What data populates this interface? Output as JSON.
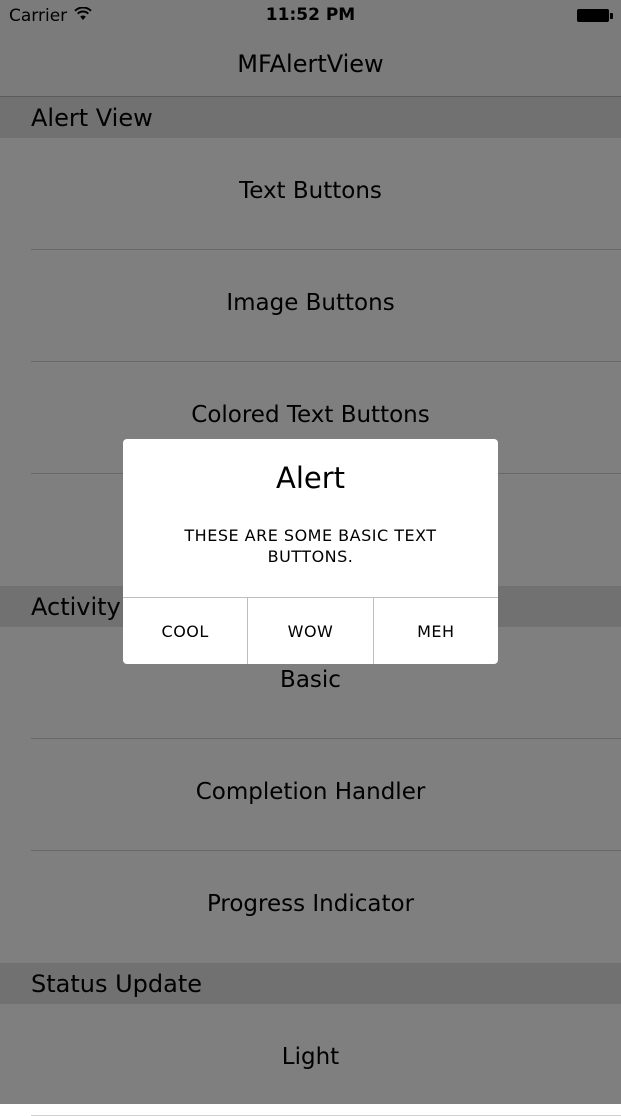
{
  "status_bar": {
    "carrier": "Carrier",
    "time": "11:52 PM"
  },
  "nav": {
    "title": "MFAlertView"
  },
  "sections": [
    {
      "header": "Alert View",
      "items": [
        "Text Buttons",
        "Image Buttons",
        "Colored Text Buttons",
        ""
      ]
    },
    {
      "header": "Activity",
      "items": [
        "Basic",
        "Completion Handler",
        "Progress Indicator"
      ]
    },
    {
      "header": "Status Update",
      "items": [
        "Light"
      ]
    }
  ],
  "alert": {
    "title": "Alert",
    "message": "THESE ARE SOME BASIC TEXT BUTTONS.",
    "buttons": [
      "COOL",
      "WOW",
      "MEH"
    ]
  },
  "colors": {
    "background": "#f7f7f7",
    "section_header": "#e3e3e3",
    "overlay": "rgba(0,0,0,0.5)",
    "text": "#000000"
  }
}
